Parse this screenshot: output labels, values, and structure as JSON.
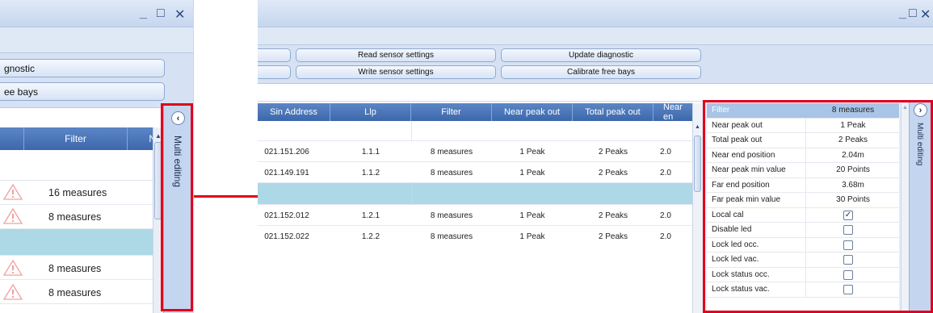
{
  "left_panel": {
    "window_controls": {
      "minimize": "_",
      "maximize": "□",
      "close": "✕"
    },
    "buttons": {
      "diagnostic": "gnostic",
      "free_bays": "ee bays"
    },
    "grid": {
      "header_filter": "Filter",
      "header_next": "N"
    },
    "rows": [
      {
        "filter": "16 measures",
        "warning": true
      },
      {
        "filter": "8 measures",
        "warning": true
      },
      {
        "filter": "",
        "warning": false,
        "selected": true
      },
      {
        "filter": "8 measures",
        "warning": true
      },
      {
        "filter": "8 measures",
        "warning": true
      }
    ],
    "side_tab_label": "Multi editing",
    "side_tab_button": "‹"
  },
  "right_panel": {
    "window_controls": {
      "minimize": "_",
      "maximize": "□",
      "close": "✕"
    },
    "buttons": {
      "read_sensor_settings": "Read sensor settings",
      "update_diagnostic": "Update diagnostic",
      "write_sensor_settings": "Write sensor settings",
      "calibrate_free_bays": "Calibrate free bays"
    },
    "grid": {
      "headers": [
        "Sin Address",
        "Llp",
        "Filter",
        "Near peak out",
        "Total peak out",
        "Near en"
      ],
      "rows": [
        {
          "address": "021.151.206",
          "llp": "1.1.1",
          "filter": "8 measures",
          "near_peak_out": "1 Peak",
          "total_peak_out": "2 Peaks",
          "near_en": "2.0"
        },
        {
          "address": "021.149.191",
          "llp": "1.1.2",
          "filter": "8 measures",
          "near_peak_out": "1 Peak",
          "total_peak_out": "2 Peaks",
          "near_en": "2.0"
        },
        {
          "address": "",
          "llp": "",
          "filter": "",
          "near_peak_out": "",
          "total_peak_out": "",
          "near_en": "",
          "selected": true
        },
        {
          "address": "021.152.012",
          "llp": "1.2.1",
          "filter": "8 measures",
          "near_peak_out": "1 Peak",
          "total_peak_out": "2 Peaks",
          "near_en": "2.0"
        },
        {
          "address": "021.152.022",
          "llp": "1.2.2",
          "filter": "8 measures",
          "near_peak_out": "1 Peak",
          "total_peak_out": "2 Peaks",
          "near_en": "2.0"
        }
      ]
    },
    "properties": {
      "header": {
        "name": "Filter",
        "value": "8 measures"
      },
      "rows": [
        {
          "name": "Near peak out",
          "value": "1 Peak"
        },
        {
          "name": "Total peak out",
          "value": "2 Peaks"
        },
        {
          "name": "Near end position",
          "value": "2.04m"
        },
        {
          "name": "Near peak min value",
          "value": "20 Points"
        },
        {
          "name": "Far end position",
          "value": "3.68m"
        },
        {
          "name": "Far peak min value",
          "value": "30 Points"
        }
      ],
      "checks": [
        {
          "name": "Local cal",
          "checked": true
        },
        {
          "name": "Disable led",
          "checked": false
        },
        {
          "name": "Lock led occ.",
          "checked": false
        },
        {
          "name": "Lock led vac.",
          "checked": false
        },
        {
          "name": "Lock status occ.",
          "checked": false
        },
        {
          "name": "Lock status vac.",
          "checked": false
        }
      ],
      "check_mark": "✓"
    },
    "side_tab_label": "Multi editing",
    "side_tab_button": "›"
  },
  "colors": {
    "highlight": "#e0001b",
    "selected_row": "#add8e6",
    "header_blue": "#4a74b8"
  }
}
